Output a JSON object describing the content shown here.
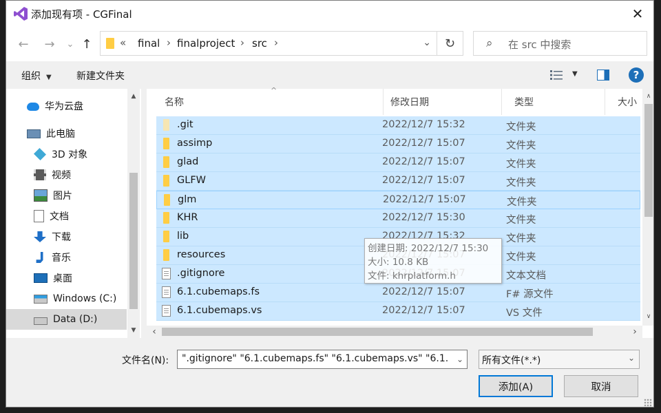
{
  "window": {
    "title": "添加现有项 - CGFinal",
    "close_glyph": "✕"
  },
  "nav": {
    "back_glyph": "←",
    "forward_glyph": "→",
    "recent_glyph": "⌄",
    "up_glyph": "↑",
    "refresh_glyph": "↻",
    "address": {
      "overflow": "«",
      "crumbs": [
        "final",
        "finalproject",
        "src"
      ],
      "separator": "›",
      "dropdown_glyph": "⌄"
    },
    "search": {
      "placeholder": "在 src 中搜索",
      "icon": "⌕"
    }
  },
  "toolbar": {
    "organize": "组织",
    "organize_caret": "▼",
    "new_folder": "新建文件夹",
    "view_caret": "▼",
    "help": "?"
  },
  "sidebar": {
    "items": [
      {
        "label": "华为云盘",
        "icon": "cloud-icon"
      },
      {
        "label": "此电脑",
        "icon": "computer-icon"
      },
      {
        "label": "3D 对象",
        "icon": "3d-objects-icon"
      },
      {
        "label": "视频",
        "icon": "video-icon"
      },
      {
        "label": "图片",
        "icon": "pictures-icon"
      },
      {
        "label": "文档",
        "icon": "documents-icon"
      },
      {
        "label": "下载",
        "icon": "download-icon"
      },
      {
        "label": "音乐",
        "icon": "music-icon"
      },
      {
        "label": "桌面",
        "icon": "desktop-icon"
      },
      {
        "label": "Windows (C:)",
        "icon": "drive-c-icon"
      },
      {
        "label": "Data (D:)",
        "icon": "drive-d-icon",
        "selected": true
      }
    ],
    "scroll_up": "▲",
    "scroll_down": "▼"
  },
  "file_list": {
    "columns": [
      "名称",
      "修改日期",
      "类型",
      "大小"
    ],
    "sort_indicator": "^",
    "rows": [
      {
        "name": ".git",
        "date": "2022/12/7 15:32",
        "type": "文件夹",
        "kind": "folder-faded"
      },
      {
        "name": "assimp",
        "date": "2022/12/7 15:07",
        "type": "文件夹",
        "kind": "folder"
      },
      {
        "name": "glad",
        "date": "2022/12/7 15:07",
        "type": "文件夹",
        "kind": "folder"
      },
      {
        "name": "GLFW",
        "date": "2022/12/7 15:07",
        "type": "文件夹",
        "kind": "folder"
      },
      {
        "name": "glm",
        "date": "2022/12/7 15:07",
        "type": "文件夹",
        "kind": "folder"
      },
      {
        "name": "KHR",
        "date": "2022/12/7 15:30",
        "type": "文件夹",
        "kind": "folder"
      },
      {
        "name": "lib",
        "date": "2022/12/7 15:32",
        "type": "文件夹",
        "kind": "folder"
      },
      {
        "name": "resources",
        "date": "2022/12/7 15:07",
        "type": "文件夹",
        "kind": "folder"
      },
      {
        "name": ".gitignore",
        "date": "2022/12/7 15:07",
        "type": "文本文档",
        "kind": "doc"
      },
      {
        "name": "6.1.cubemaps.fs",
        "date": "2022/12/7 15:07",
        "type": "F# 源文件",
        "kind": "doc"
      },
      {
        "name": "6.1.cubemaps.vs",
        "date": "2022/12/7 15:07",
        "type": "VS 文件",
        "kind": "doc"
      }
    ],
    "scroll_up": "∧",
    "scroll_down": "∨",
    "scroll_left": "‹",
    "scroll_right": "›"
  },
  "tooltip": {
    "lines": [
      "创建日期: 2022/12/7 15:30",
      "大小: 10.8 KB",
      "文件: khrplatform.h"
    ]
  },
  "footer": {
    "filename_label": "文件名(N):",
    "filename_value": "\".gitignore\" \"6.1.cubemaps.fs\" \"6.1.cubemaps.vs\" \"6.1.",
    "filetype_value": "所有文件(*.*)",
    "dropdown_glyph": "⌄",
    "add_button": "添加(A)",
    "cancel_button": "取消"
  },
  "colors": {
    "selection": "#cce8ff",
    "accent": "#0078d7",
    "folder": "#ffcd44"
  }
}
